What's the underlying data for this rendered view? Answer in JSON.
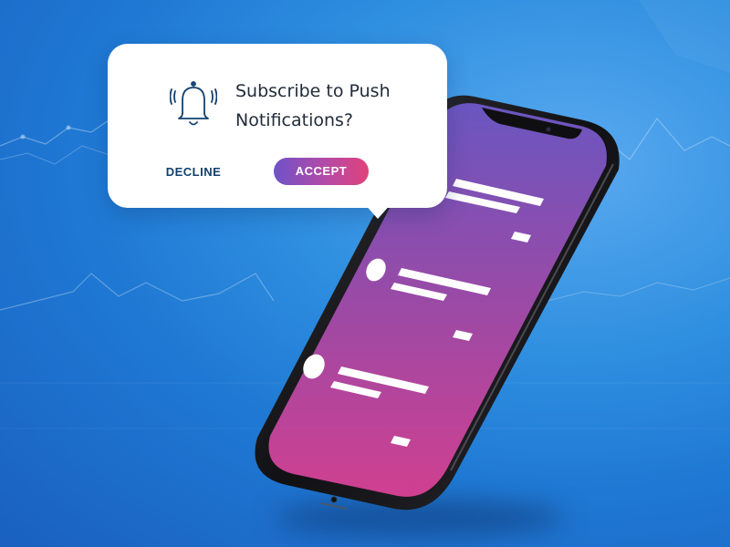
{
  "dialog": {
    "title": "Subscribe to Push Notifications?",
    "decline_label": "DECLINE",
    "accept_label": "ACCEPT",
    "icon": "bell-icon"
  },
  "colors": {
    "background": "#2f8fe0",
    "title_text": "#222c3a",
    "decline_text": "#13406e",
    "accept_gradient_start": "#6f52c8",
    "accept_gradient_end": "#e0427a",
    "screen_gradient_top": "#6a56c0",
    "screen_gradient_bottom": "#d04090",
    "phone_frame": "#1a1a1e"
  }
}
